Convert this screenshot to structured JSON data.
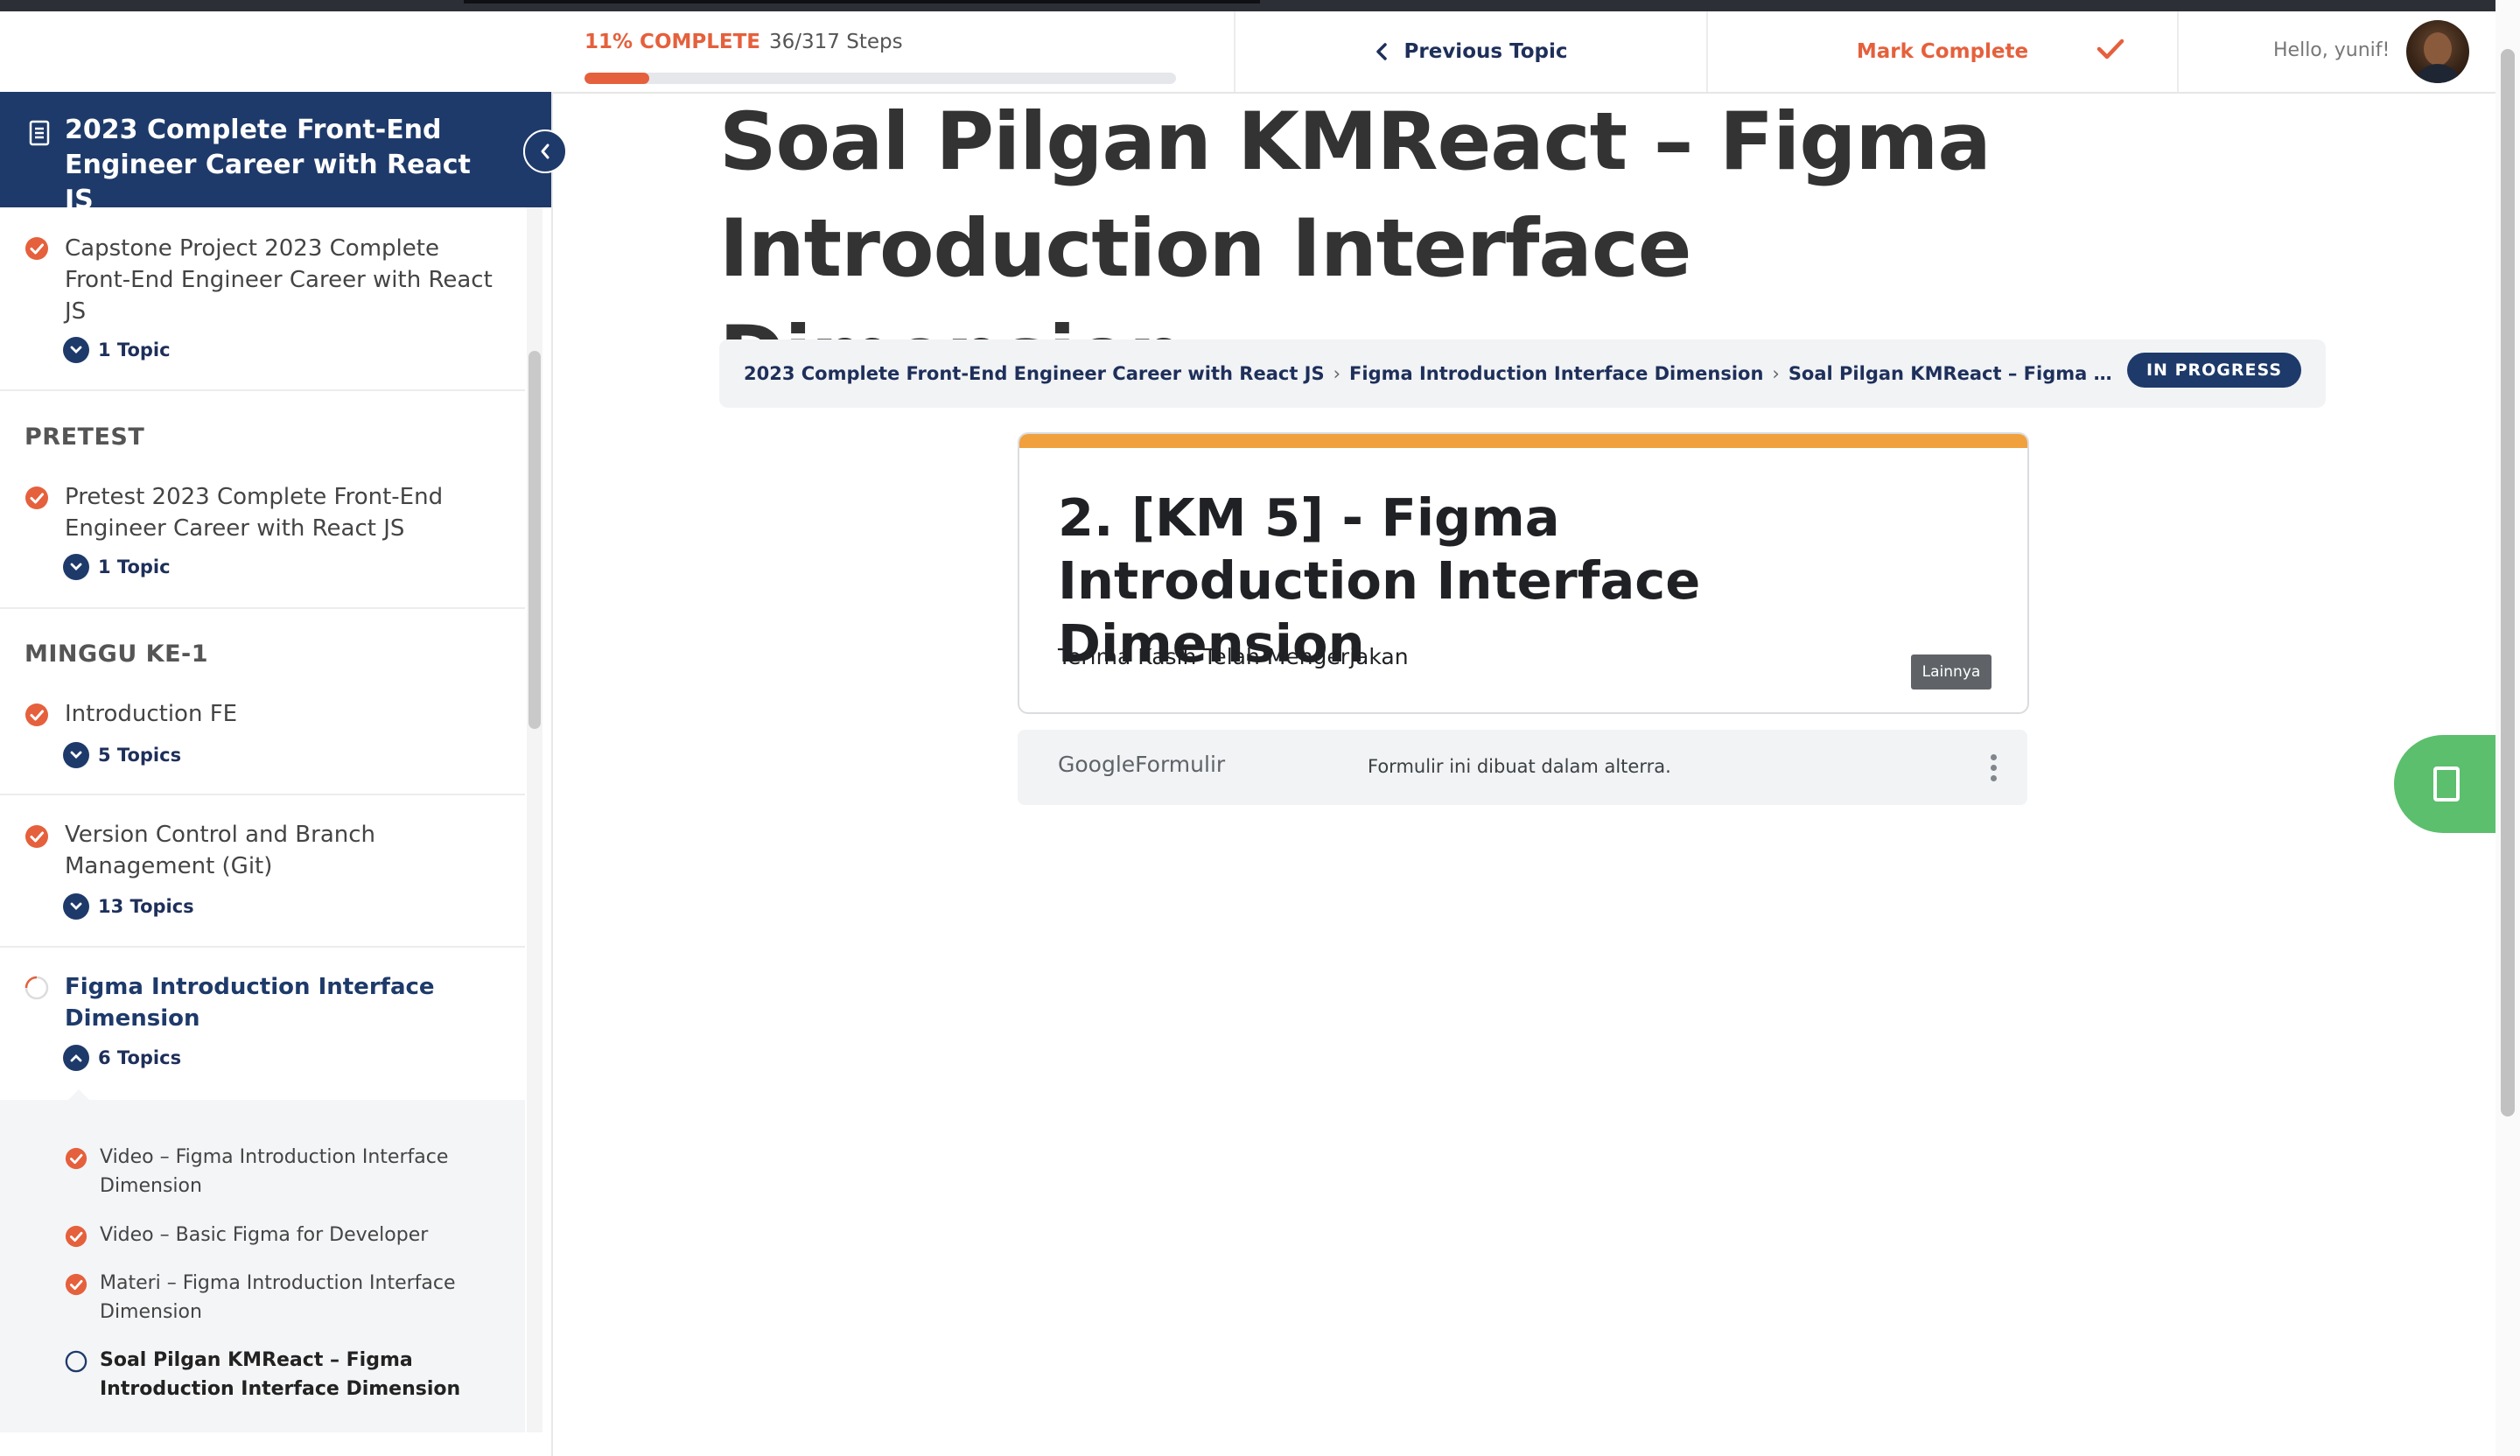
{
  "header": {
    "progress_percent": "11% COMPLETE",
    "progress_steps": "36/317 Steps",
    "progress_fraction": 0.11,
    "previous_topic": "Previous Topic",
    "mark_complete": "Mark Complete",
    "greeting": "Hello, yunif!"
  },
  "sidebar": {
    "course_title": "2023 Complete Front-End Engineer Career with React JS",
    "lessons": [
      {
        "title": "Capstone Project 2023 Complete Front-End Engineer Career with React JS",
        "topics": "1 Topic"
      },
      {
        "title": "Pretest 2023 Complete Front-End Engineer Career with React JS",
        "topics": "1 Topic"
      },
      {
        "title": "Introduction FE",
        "topics": "5 Topics"
      },
      {
        "title": "Version Control and Branch Management (Git)",
        "topics": "13 Topics"
      },
      {
        "title": "Figma Introduction Interface Dimension",
        "topics": "6 Topics"
      }
    ],
    "sections": [
      "PRETEST",
      "MINGGU KE-1"
    ],
    "subtopics": [
      "Video – Figma Introduction Interface Dimension",
      "Video – Basic Figma for Developer",
      "Materi – Figma Introduction Interface Dimension",
      "Soal Pilgan KMReact – Figma Introduction Interface Dimension"
    ]
  },
  "main": {
    "title": "Soal Pilgan KMReact – Figma Introduction Interface Dimension",
    "breadcrumb": [
      "2023 Complete Front-End Engineer Career with React JS",
      "Figma Introduction Interface Dimension",
      "Soal Pilgan KMReact – Figma Introductio..."
    ],
    "status": "IN PROGRESS"
  },
  "form": {
    "title": "2. [KM 5] - Figma Introduction Interface Dimension",
    "description": "Terima Kasih Telah Mengerjakan",
    "more_button": "Lainnya",
    "footer_brand_google": "Google",
    "footer_brand_product": "Formulir",
    "footer_note": "Formulir ini dibuat dalam alterra."
  },
  "colors": {
    "accent_orange": "#e5603c",
    "navy": "#1e3a6a",
    "form_accent": "#f0a03c",
    "float_green": "#5bbf6e"
  }
}
